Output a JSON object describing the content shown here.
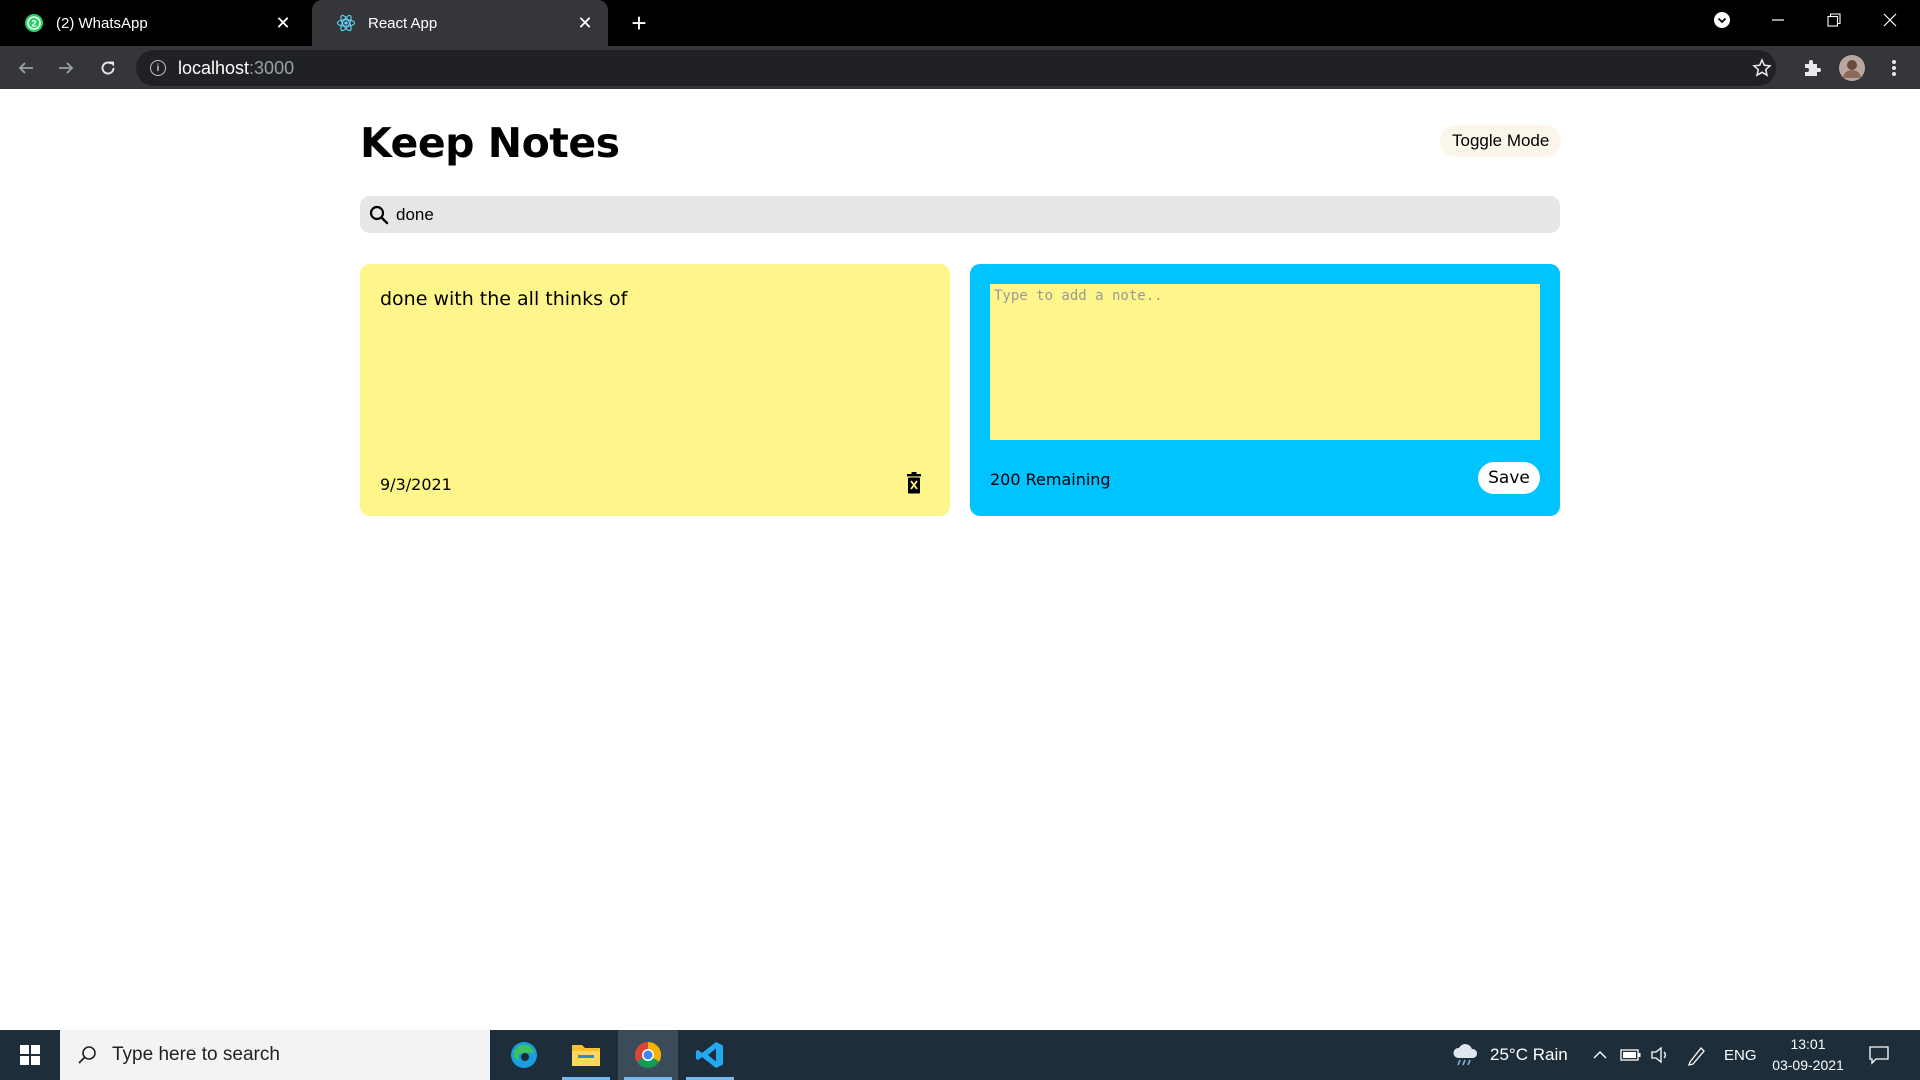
{
  "browser": {
    "tabs": [
      {
        "label": "(2) WhatsApp",
        "icon": "whatsapp-icon"
      },
      {
        "label": "React App",
        "icon": "react-icon"
      }
    ],
    "url_host": "localhost",
    "url_port": ":3000"
  },
  "app": {
    "title": "Keep Notes",
    "toggle_label": "Toggle Mode",
    "search_value": "done",
    "notes": [
      {
        "text": "done with the all thinks of",
        "date": "9/3/2021"
      }
    ],
    "new_note": {
      "placeholder": "Type to add a note..",
      "remaining": "200 Remaining",
      "save_label": "Save"
    },
    "colors": {
      "note_bg": "#fef68a",
      "new_note_bg": "#00c4ff",
      "search_bg": "#e6e6e6"
    }
  },
  "taskbar": {
    "search_placeholder": "Type here to search",
    "weather": "25°C  Rain",
    "language": "ENG",
    "time": "13:01",
    "date": "03-09-2021"
  }
}
